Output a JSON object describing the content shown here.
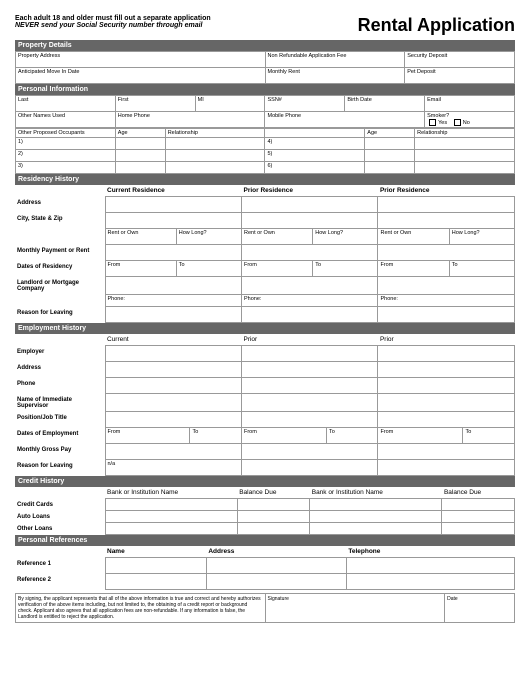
{
  "header": {
    "line1": "Each adult 18 and older must fill out a separate application",
    "line2": "NEVER send your Social Security number through email",
    "title": "Rental Application"
  },
  "sections": {
    "property": "Property Details",
    "personal": "Personal Information",
    "residency": "Residency History",
    "employment": "Employment History",
    "credit": "Credit History",
    "references": "Personal References"
  },
  "property": {
    "address": "Property Address",
    "fee": "Non Refundable Application Fee",
    "deposit": "Security Deposit",
    "movein": "Anticipated Move In Date",
    "rent": "Monthly Rent",
    "pet": "Pet Deposit"
  },
  "personal": {
    "last": "Last",
    "first": "First",
    "mi": "MI",
    "ssn": "SSN#",
    "birth": "Birth Date",
    "email": "Email",
    "other_names": "Other Names Used",
    "home_phone": "Home Phone",
    "mobile_phone": "Mobile Phone",
    "smoker": "Smoker?",
    "yes": "Yes",
    "no": "No",
    "occupants": "Other Proposed Occupants",
    "age": "Age",
    "relationship": "Relationship",
    "n1": "1)",
    "n2": "2)",
    "n3": "3)",
    "n4": "4)",
    "n5": "5)",
    "n6": "6)"
  },
  "residency": {
    "current": "Current Residence",
    "prior": "Prior Residence",
    "address": "Address",
    "city": "City, State & Zip",
    "rent_own": "Rent or Own",
    "how_long": "How Long?",
    "monthly": "Monthly Payment or Rent",
    "dates": "Dates of Residency",
    "from": "From",
    "to": "To",
    "landlord": "Landlord or Mortgage Company",
    "phone": "Phone:",
    "reason": "Reason for Leaving"
  },
  "employment": {
    "current": "Current",
    "prior": "Prior",
    "employer": "Employer",
    "address": "Address",
    "phone": "Phone",
    "supervisor": "Name of Immediate Supervisor",
    "position": "Position/Job Title",
    "dates": "Dates of Employment",
    "from": "From",
    "to": "To",
    "gross": "Monthly Gross Pay",
    "reason": "Reason for Leaving",
    "na": "n/a"
  },
  "credit": {
    "bank": "Bank or Institution Name",
    "balance": "Balance Due",
    "cc": "Credit Cards",
    "auto": "Auto Loans",
    "other": "Other Loans"
  },
  "references": {
    "name": "Name",
    "address": "Address",
    "telephone": "Telephone",
    "r1": "Reference 1",
    "r2": "Reference 2"
  },
  "footer": {
    "disclaimer": "By signing, the applicant represents that all of the above information is true and correct and hereby authorizes verification of the above items including, but not limited to, the obtaining of a credit report or background check. Applicant also agrees that all application fees are non-refundable. If any information is false, the Landlord is entitled to reject the application.",
    "signature": "Signature",
    "date": "Date"
  }
}
